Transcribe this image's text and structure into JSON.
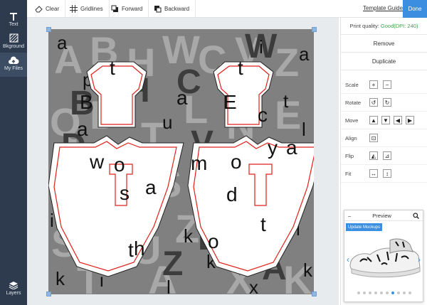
{
  "sidebar": {
    "items": [
      {
        "label": "Text",
        "icon": "text-icon"
      },
      {
        "label": "Bkground",
        "icon": "background-icon"
      },
      {
        "label": "My Files",
        "icon": "upload-cloud-icon"
      }
    ],
    "bottom": {
      "label": "Layers",
      "icon": "layers-icon"
    }
  },
  "toolbar": {
    "clear": "Clear",
    "gridlines": "Gridlines",
    "forward": "Forward",
    "backward": "Backward",
    "template_guide": "Template Guide",
    "done": "Done"
  },
  "panel": {
    "print_quality_label": "Print quality:",
    "print_quality_value": "Good(DPI: 240)",
    "remove": "Remove",
    "duplicate": "Duplicate",
    "scale": "Scale",
    "rotate": "Rotate",
    "move": "Move",
    "align": "Align",
    "flip": "Flip",
    "fit": "Fit"
  },
  "preview": {
    "title": "Preview",
    "update_button": "Update Mockups",
    "page_count": 10,
    "active_page": 7
  },
  "colors": {
    "sidebar_bg": "#2e3b4e",
    "accent": "#3b8ee0",
    "good": "#3da24a",
    "template_outline": "#e0201a"
  }
}
